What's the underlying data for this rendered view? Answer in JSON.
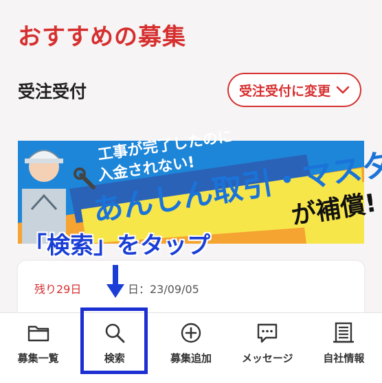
{
  "title": "おすすめの募集",
  "section_label": "受注受付",
  "filter_button": {
    "label": "受注受付に変更",
    "icon": "chevron-down-icon"
  },
  "banner": {
    "line1": "工事が完了したのに",
    "line2": "入金されない!",
    "headline": "あんしん取引・マスター",
    "tail": "が補償!"
  },
  "annotation": "「検索」をタップ",
  "card": {
    "days_left": "残り29日",
    "date": "日：23/09/05"
  },
  "tabs": [
    {
      "label": "募集一覧",
      "icon": "folder-icon"
    },
    {
      "label": "検索",
      "icon": "search-icon"
    },
    {
      "label": "募集追加",
      "icon": "plus-circle-icon"
    },
    {
      "label": "メッセージ",
      "icon": "chat-bubble-icon"
    },
    {
      "label": "自社情報",
      "icon": "building-icon"
    }
  ],
  "colors": {
    "accent": "#d62f2f",
    "annotation": "#1b3fd6",
    "banner_bg": "#f5a331"
  }
}
